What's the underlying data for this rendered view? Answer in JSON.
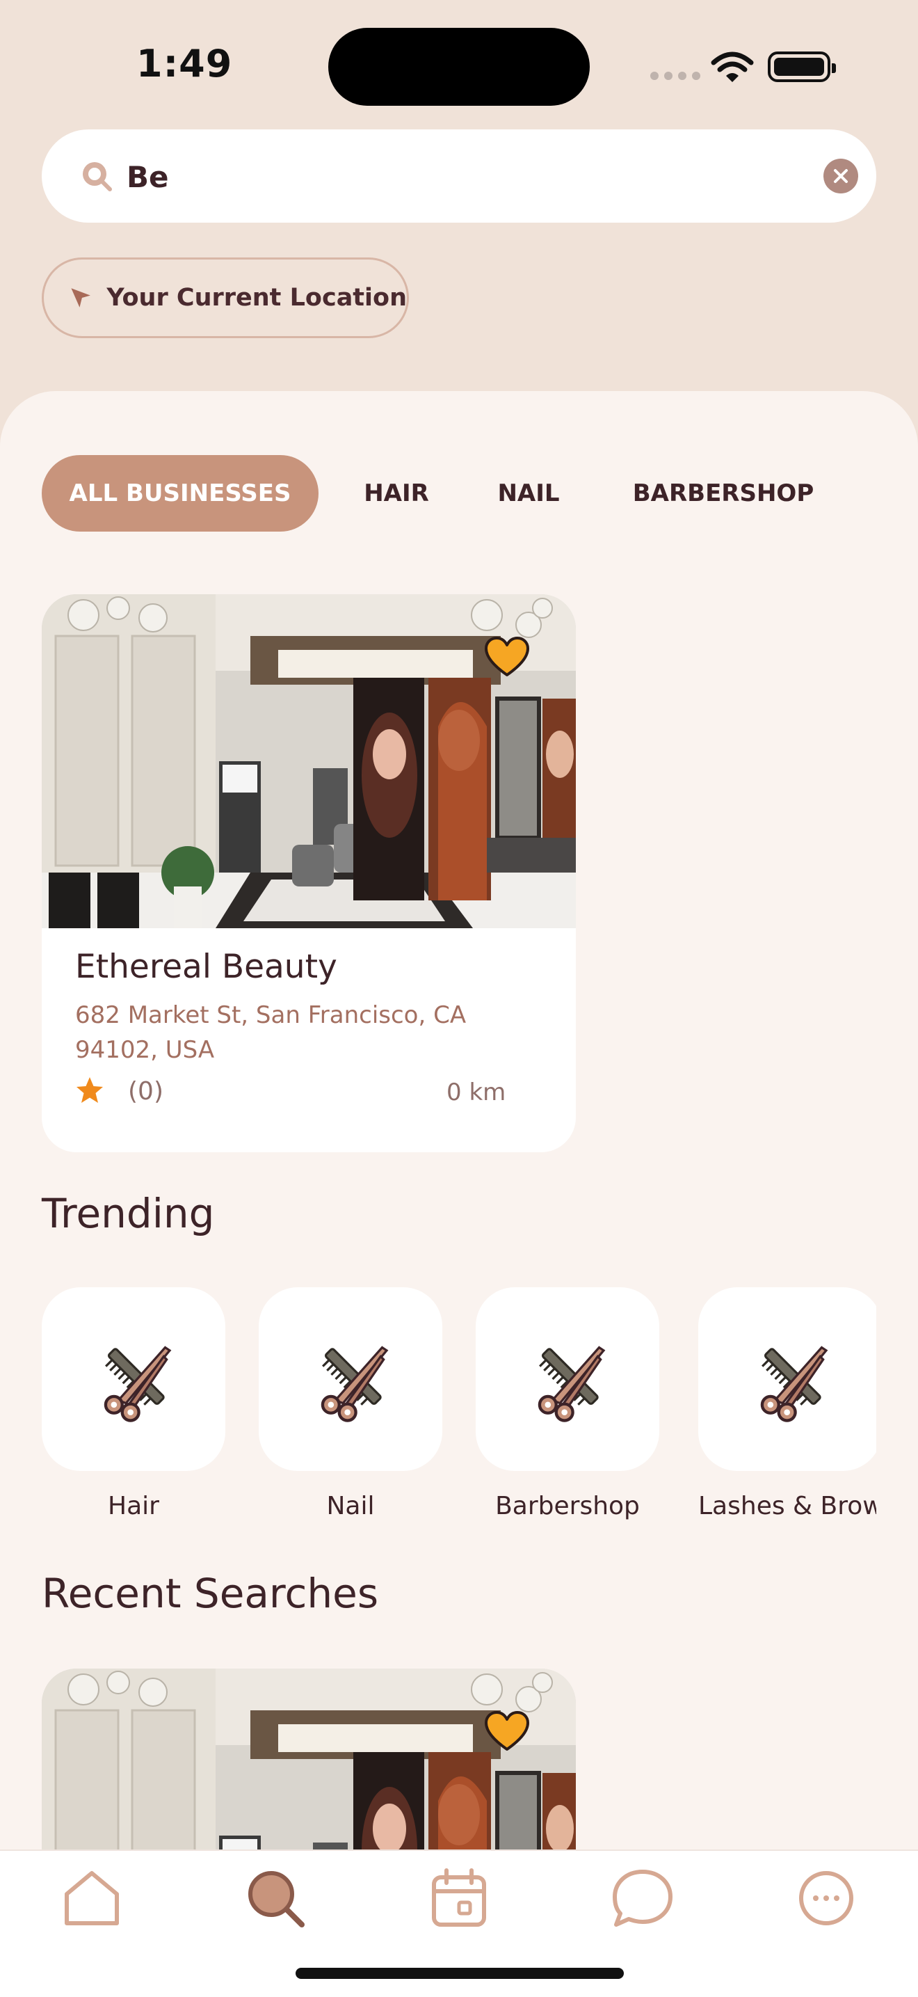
{
  "status_bar": {
    "time": "1:49"
  },
  "search": {
    "value": "Be",
    "placeholder": ""
  },
  "location": {
    "label": "Your Current Location"
  },
  "tabs": [
    {
      "label": "ALL BUSINESSES",
      "active": true
    },
    {
      "label": "HAIR",
      "active": false
    },
    {
      "label": "NAIL",
      "active": false
    },
    {
      "label": "BARBERSHOP",
      "active": false
    }
  ],
  "results": [
    {
      "name": "Ethereal Beauty",
      "address": "682 Market St, San Francisco, CA 94102, USA",
      "rating_count": "(0)",
      "distance": "0 km",
      "favorite": true
    }
  ],
  "trending": {
    "title": "Trending",
    "categories": [
      {
        "label": "Hair",
        "icon": "scissors-comb-icon"
      },
      {
        "label": "Nail",
        "icon": "scissors-comb-icon"
      },
      {
        "label": "Barbershop",
        "icon": "scissors-comb-icon"
      },
      {
        "label": "Lashes & Brows",
        "icon": "scissors-comb-icon"
      }
    ]
  },
  "recent": {
    "title": "Recent Searches"
  },
  "bottom_nav": [
    {
      "icon": "home-icon",
      "active": false
    },
    {
      "icon": "search-icon",
      "active": true
    },
    {
      "icon": "calendar-icon",
      "active": false
    },
    {
      "icon": "chat-icon",
      "active": false
    },
    {
      "icon": "more-icon",
      "active": false
    }
  ],
  "colors": {
    "accent": "#C8947C",
    "background": "#F0E2D8",
    "surface": "#FAF3EF",
    "text": "#3D2328",
    "address": "#A36F60",
    "favorite": "#F6A623",
    "star": "#F08A1C"
  }
}
